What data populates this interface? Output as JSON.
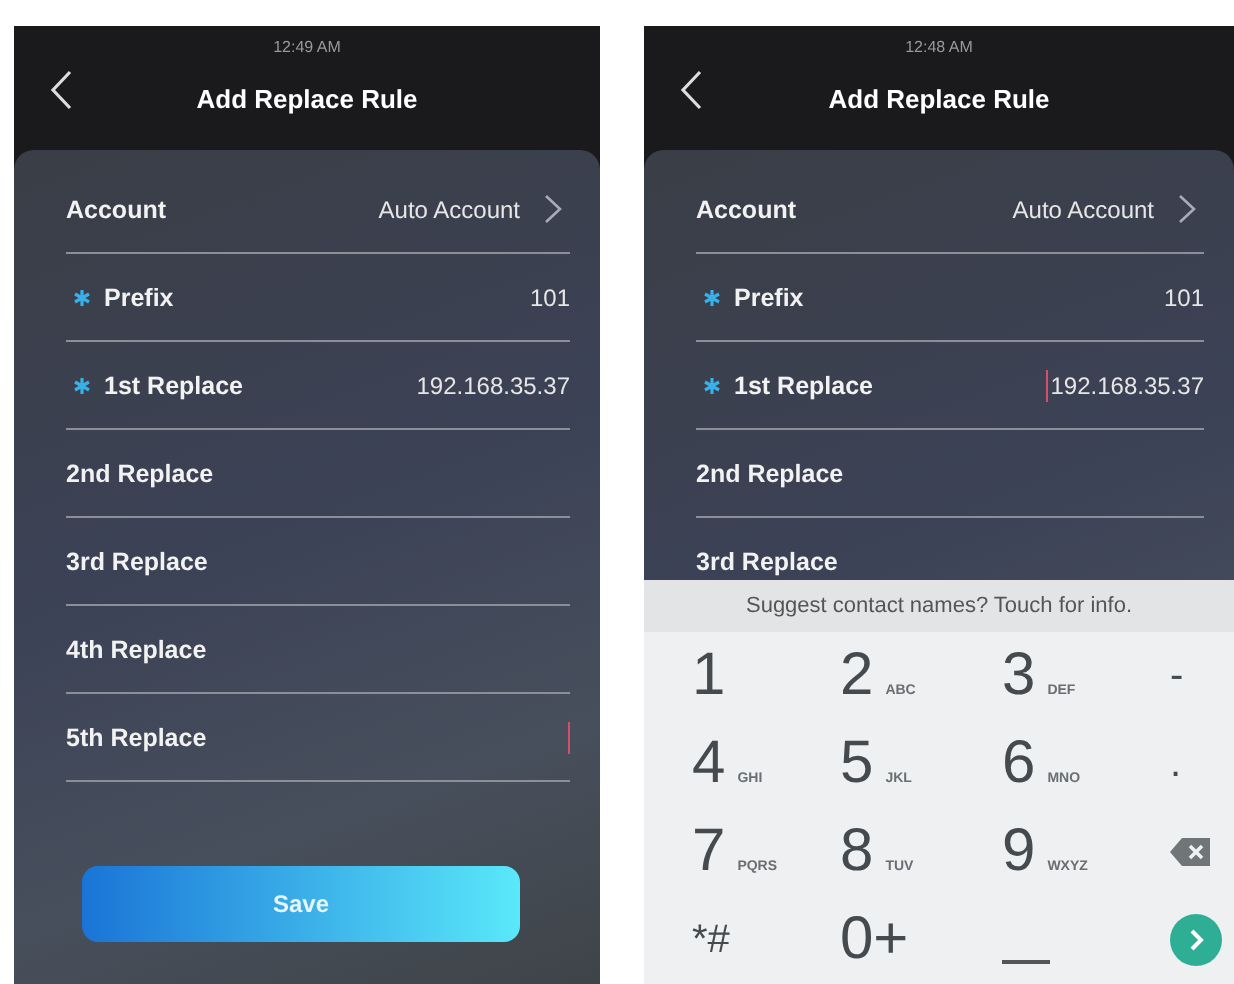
{
  "screens": [
    {
      "status_time": "12:49 AM",
      "title": "Add Replace Rule",
      "fields": [
        {
          "kind": "select",
          "label": "Account",
          "value": "Auto Account",
          "required": false,
          "cursor": false
        },
        {
          "kind": "text",
          "label": "Prefix",
          "value": "101",
          "required": true,
          "cursor": false
        },
        {
          "kind": "text",
          "label": "1st Replace",
          "value": "192.168.35.37",
          "required": true,
          "cursor": false
        },
        {
          "kind": "text",
          "label": "2nd Replace",
          "required": false,
          "cursor": false
        },
        {
          "kind": "text",
          "label": "3rd Replace",
          "required": false,
          "cursor": false
        },
        {
          "kind": "text",
          "label": "4th Replace",
          "required": false,
          "cursor": false
        },
        {
          "kind": "text",
          "label": "5th Replace",
          "required": false,
          "cursor": true
        }
      ],
      "save_button": "Save"
    },
    {
      "status_time": "12:48 AM",
      "title": "Add Replace Rule",
      "fields": [
        {
          "kind": "select",
          "label": "Account",
          "value": "Auto Account",
          "required": false,
          "cursor": false
        },
        {
          "kind": "text",
          "label": "Prefix",
          "value": "101",
          "required": true,
          "cursor": false
        },
        {
          "kind": "text",
          "label": "1st Replace",
          "value": "192.168.35.37",
          "required": true,
          "cursor": true
        },
        {
          "kind": "text",
          "label": "2nd Replace",
          "required": false,
          "cursor": false
        },
        {
          "kind": "text",
          "label": "3rd Replace",
          "required": false,
          "cursor": false
        }
      ],
      "keyboard": {
        "suggestion": "Suggest contact names? Touch for info.",
        "keys": [
          {
            "kind": "digit",
            "main": "1"
          },
          {
            "kind": "digit",
            "main": "2",
            "sub": "ABC"
          },
          {
            "kind": "digit",
            "main": "3",
            "sub": "DEF"
          },
          {
            "kind": "symbol",
            "main": "-"
          },
          {
            "kind": "digit",
            "main": "4",
            "sub": "GHI"
          },
          {
            "kind": "digit",
            "main": "5",
            "sub": "JKL"
          },
          {
            "kind": "digit",
            "main": "6",
            "sub": "MNO"
          },
          {
            "kind": "symbol",
            "main": "."
          },
          {
            "kind": "digit",
            "main": "7",
            "sub": "PQRS"
          },
          {
            "kind": "digit",
            "main": "8",
            "sub": "TUV"
          },
          {
            "kind": "digit",
            "main": "9",
            "sub": "WXYZ"
          },
          {
            "kind": "backspace"
          },
          {
            "kind": "symbol",
            "main": "*#"
          },
          {
            "kind": "digit",
            "main": "0+"
          },
          {
            "kind": "space"
          },
          {
            "kind": "enter"
          }
        ]
      }
    }
  ]
}
